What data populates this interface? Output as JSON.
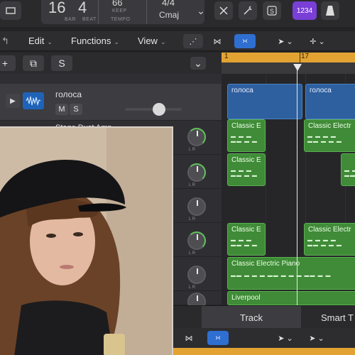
{
  "lcd": {
    "bar_value": "16",
    "beat_value": "4",
    "bar_label": "BAR",
    "beat_label": "BEAT",
    "tempo_value": "66",
    "keep_label": "KEEP",
    "tempo_label": "TEMPO",
    "time_signature": "4/4",
    "key": "Cmaj"
  },
  "top_buttons": {
    "count_in": "1234"
  },
  "toolbar": {
    "edit": "Edit",
    "functions": "Functions",
    "view": "View"
  },
  "track_header": {
    "add": "+",
    "solo": "S"
  },
  "ruler": {
    "bar1": "1",
    "bar17": "17"
  },
  "tracks": [
    {
      "name": "голоса",
      "mute": "M",
      "solo": "S",
      "volume_fraction": 0.6
    },
    {
      "name": "Stage Dust Amp"
    }
  ],
  "regions": {
    "voice1": "голоса",
    "voice2": "голоса",
    "ep1": "Classic E",
    "ep2": "Classic Electr",
    "ep3": "Classic E",
    "ep4": "Classic E",
    "ep5": "Classic Electr",
    "ep6": "Classic Electric Piano",
    "liverpool": "Liverpool"
  },
  "bottom_tabs": {
    "track": "Track",
    "smart": "Smart T"
  },
  "colors": {
    "accent_purple": "#7a3fd6",
    "ruler_orange": "#e3a333",
    "region_blue": "#2e5f9f",
    "region_green": "#3f8b37",
    "button_blue": "#2f6fd1"
  }
}
